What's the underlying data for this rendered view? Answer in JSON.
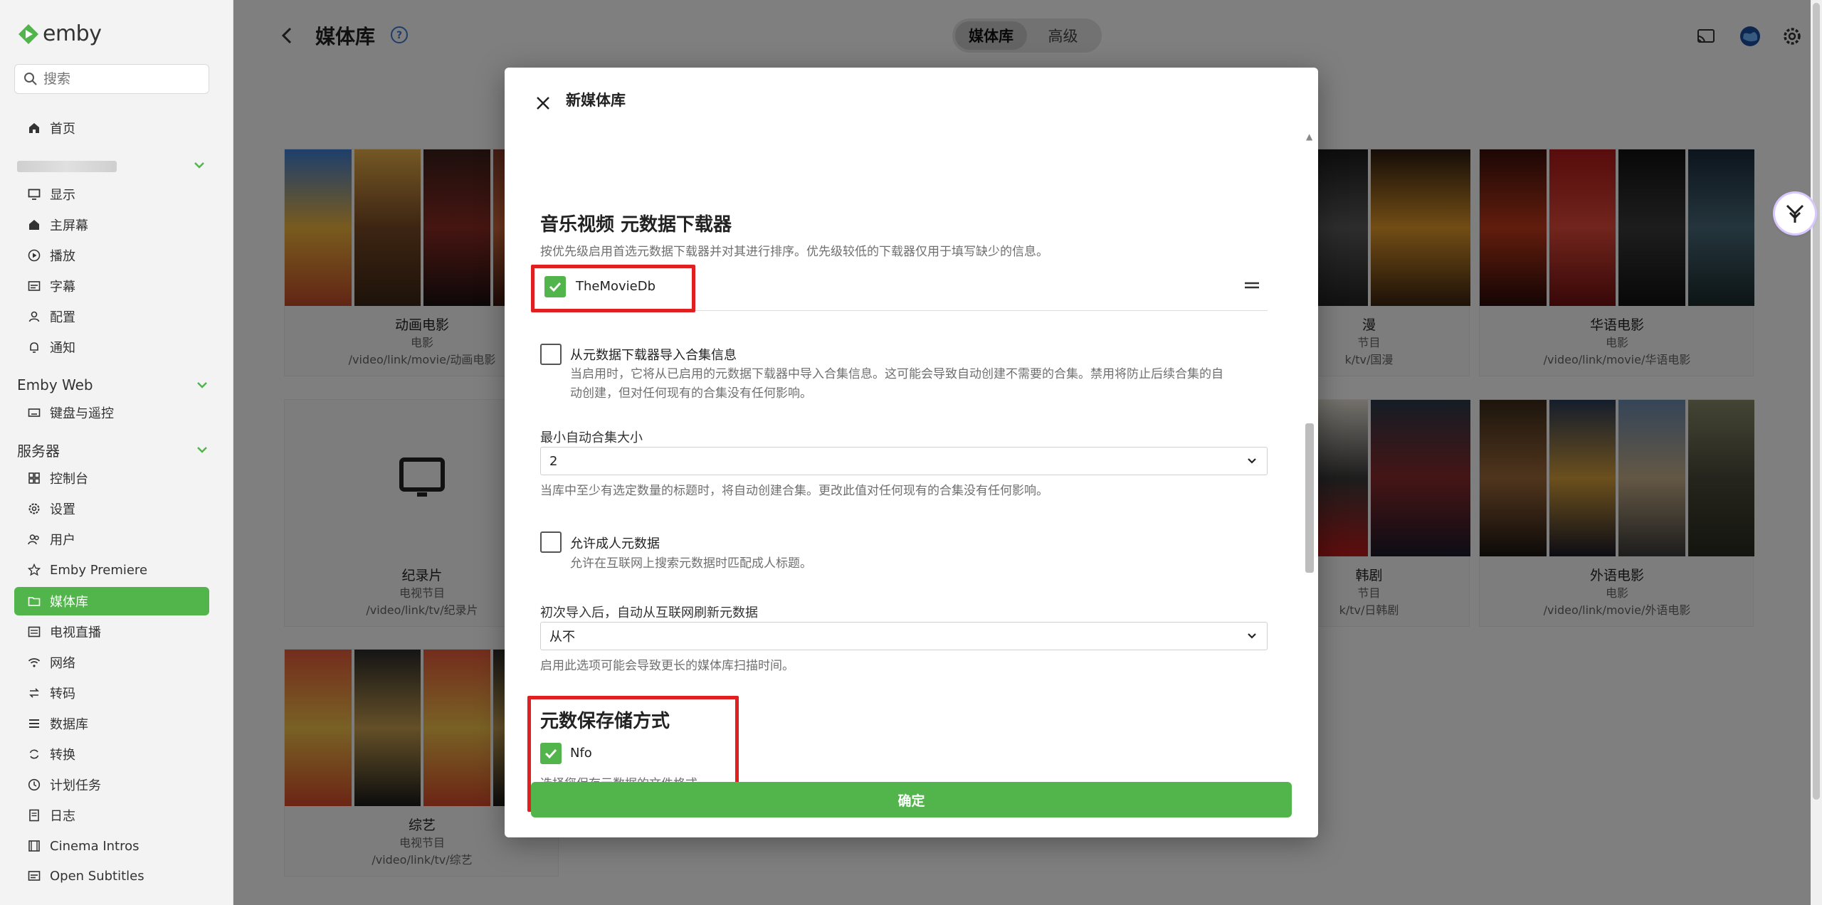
{
  "app": {
    "brand": "emby"
  },
  "sidebar": {
    "search_placeholder": "搜索",
    "home": "首页",
    "user_items": [
      "显示",
      "主屏幕",
      "播放",
      "字幕",
      "配置",
      "通知"
    ],
    "emby_web_header": "Emby Web",
    "emby_web_items": [
      "键盘与遥控"
    ],
    "server_header": "服务器",
    "server_items": [
      "控制台",
      "设置",
      "用户",
      "Emby Premiere",
      "媒体库",
      "电视直播",
      "网络",
      "转码",
      "数据库",
      "转换",
      "计划任务",
      "日志",
      "Cinema Intros",
      "Open Subtitles"
    ],
    "active_item": "媒体库"
  },
  "header": {
    "title": "媒体库",
    "segment_tabs": [
      "媒体库",
      "高级"
    ],
    "active_tab": "媒体库"
  },
  "libraries": [
    {
      "name": "动画电影",
      "type": "电影",
      "path": "/video/link/movie/动画电影"
    },
    {
      "name": "漫",
      "type": "节目",
      "path": "k/tv/国漫"
    },
    {
      "name": "华语电影",
      "type": "电影",
      "path": "/video/link/movie/华语电影"
    },
    {
      "name": "纪录片",
      "type": "电视节目",
      "path": "/video/link/tv/纪录片"
    },
    {
      "name": "韩剧",
      "type": "节目",
      "path": "k/tv/日韩剧"
    },
    {
      "name": "外语电影",
      "type": "电影",
      "path": "/video/link/movie/外语电影"
    },
    {
      "name": "综艺",
      "type": "电视节目",
      "path": "/video/link/tv/综艺"
    }
  ],
  "dialog": {
    "title": "新媒体库",
    "music_video_fetchers": {
      "heading": "音乐视频 元数据下载器",
      "description": "按优先级启用首选元数据下载器并对其进行排序。优先级较低的下载器仅用于填写缺少的信息。",
      "fetcher_name": "TheMovieDb",
      "fetcher_enabled": true
    },
    "import_collections": {
      "label": "从元数据下载器导入合集信息",
      "checked": false,
      "description_line1": "当启用时，它将从已启用的元数据下载器中导入合集信息。这可能会导致自动创建不需要的合集。禁用将防止后续合集的自",
      "description_line2": "动创建，但对任何现有的合集没有任何影响。"
    },
    "min_collection_size": {
      "label": "最小自动合集大小",
      "value": "2",
      "description": "当库中至少有选定数量的标题时，将自动创建合集。更改此值对任何现有的合集没有任何影响。"
    },
    "adult_metadata": {
      "label": "允许成人元数据",
      "checked": false,
      "description": "允许在互联网上搜索元数据时匹配成人标题。"
    },
    "refresh_after_import": {
      "label": "初次导入后，自动从互联网刷新元数据",
      "value": "从不",
      "description": "启用此选项可能会导致更长的媒体库扫描时间。"
    },
    "metadata_savers": {
      "heading": "元数保存储方式",
      "saver_name": "Nfo",
      "saver_enabled": true,
      "description": "选择您保存元数据的文件格式。"
    },
    "confirm_label": "确定"
  },
  "colors": {
    "accent": "#52b54b",
    "highlight": "#e02020"
  }
}
